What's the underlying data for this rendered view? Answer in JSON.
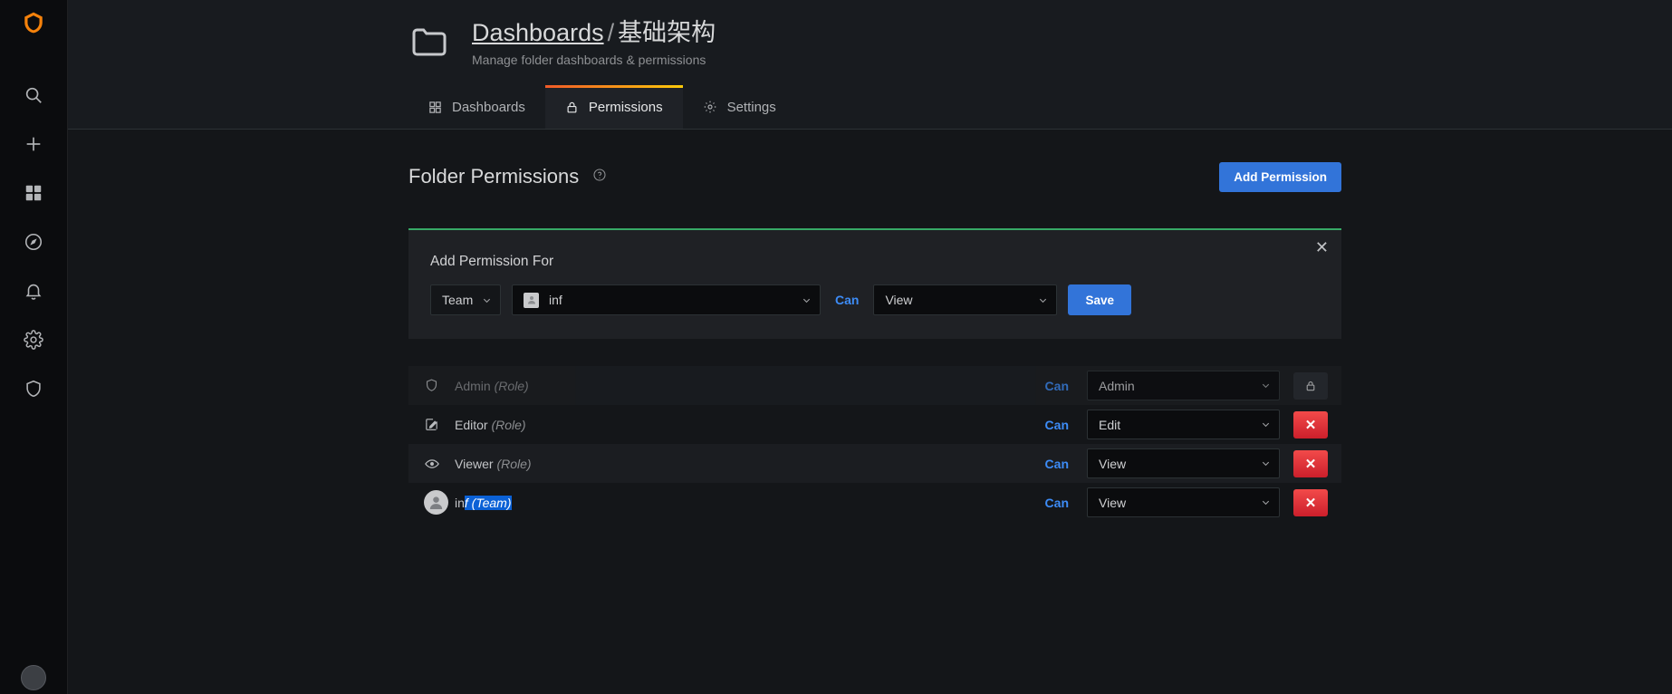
{
  "sidebar": {
    "brand_icon": "grafana-logo-icon",
    "items": [
      {
        "icon": "search-icon",
        "name": "sidebar-item-search"
      },
      {
        "icon": "plus-icon",
        "name": "sidebar-item-create"
      },
      {
        "icon": "dashboards-grid-icon",
        "name": "sidebar-item-dashboards"
      },
      {
        "icon": "compass-explore-icon",
        "name": "sidebar-item-explore"
      },
      {
        "icon": "bell-alerting-icon",
        "name": "sidebar-item-alerting"
      },
      {
        "icon": "gear-configuration-icon",
        "name": "sidebar-item-configuration"
      },
      {
        "icon": "shield-admin-icon",
        "name": "sidebar-item-server-admin"
      }
    ],
    "profile_icon": "user-avatar-icon"
  },
  "header": {
    "folder_icon": "folder-icon",
    "breadcrumb_root": "Dashboards",
    "breadcrumb_separator": "/",
    "breadcrumb_current": "基础架构",
    "subtitle": "Manage folder dashboards & permissions"
  },
  "tabs": [
    {
      "label": "Dashboards",
      "icon": "apps-grid-icon",
      "active": false
    },
    {
      "label": "Permissions",
      "icon": "lock-icon",
      "active": true
    },
    {
      "label": "Settings",
      "icon": "cog-icon",
      "active": false
    }
  ],
  "section": {
    "title": "Folder Permissions",
    "help_icon": "question-circle-icon",
    "add_permission_button": "Add Permission"
  },
  "add_panel": {
    "title": "Add Permission For",
    "close_icon": "close-x-icon",
    "accent_color": "#37a966",
    "type_select": {
      "value": "Team",
      "caret_icon": "chevron-down-icon"
    },
    "target_select": {
      "value": "inf",
      "avatar_icon": "user-avatar-icon",
      "caret_icon": "chevron-down-icon"
    },
    "can_label": "Can",
    "permission_select": {
      "value": "View",
      "caret_icon": "chevron-down-icon"
    },
    "save_button": "Save"
  },
  "permissions": {
    "can_label": "Can",
    "rows": [
      {
        "icon": "shield-icon",
        "name": "Admin",
        "qualifier": "(Role)",
        "permission": "Admin",
        "action": "lock",
        "action_icon": "lock-icon",
        "dim": true,
        "selected": false
      },
      {
        "icon": "pencil-square-icon",
        "name": "Editor",
        "qualifier": "(Role)",
        "permission": "Edit",
        "action": "delete",
        "action_icon": "close-x-icon",
        "dim": false,
        "selected": false
      },
      {
        "icon": "eye-icon",
        "name": "Viewer",
        "qualifier": "(Role)",
        "permission": "View",
        "action": "delete",
        "action_icon": "close-x-icon",
        "dim": false,
        "selected": false
      },
      {
        "icon": "user-avatar-icon",
        "name": "inf",
        "qualifier": "(Team)",
        "permission": "View",
        "action": "delete",
        "action_icon": "close-x-icon",
        "dim": false,
        "selected": true,
        "selection_start": 2
      }
    ]
  }
}
